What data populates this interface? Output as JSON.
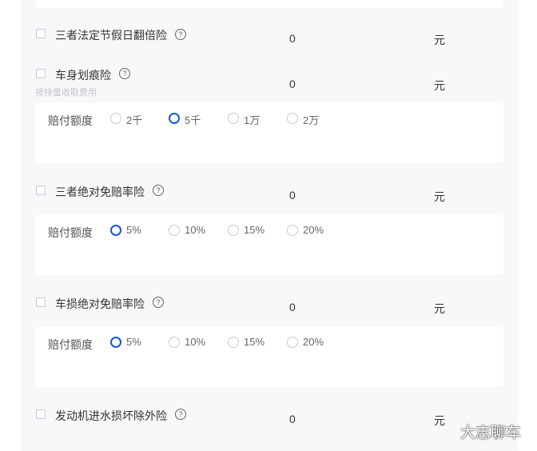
{
  "items": [
    {
      "label": "三者法定节假日翻倍险",
      "value": "0",
      "unit": "元"
    },
    {
      "label": "车身划痕险",
      "value": "0",
      "unit": "元",
      "note": "按排量收取费用"
    },
    {
      "label": "三者绝对免赔率险",
      "value": "0",
      "unit": "元"
    },
    {
      "label": "车损绝对免赔率险",
      "value": "0",
      "unit": "元"
    },
    {
      "label": "发动机进水损坏除外险",
      "value": "0",
      "unit": "元"
    }
  ],
  "help_icon_glyph": "?",
  "option_boxes": [
    {
      "label": "赔付额度",
      "options": [
        "2千",
        "5千",
        "1万",
        "2万"
      ],
      "selected": "5千"
    },
    {
      "label": "赔付额度",
      "options": [
        "5%",
        "10%",
        "15%",
        "20%"
      ],
      "selected": "5%"
    },
    {
      "label": "赔付额度",
      "options": [
        "5%",
        "10%",
        "15%",
        "20%"
      ],
      "selected": "5%"
    }
  ],
  "watermark": "大志聊车",
  "colors": {
    "accent": "#1a56db",
    "panel_bg": "#f7f8fa",
    "muted_note": "#c3c6cc"
  }
}
